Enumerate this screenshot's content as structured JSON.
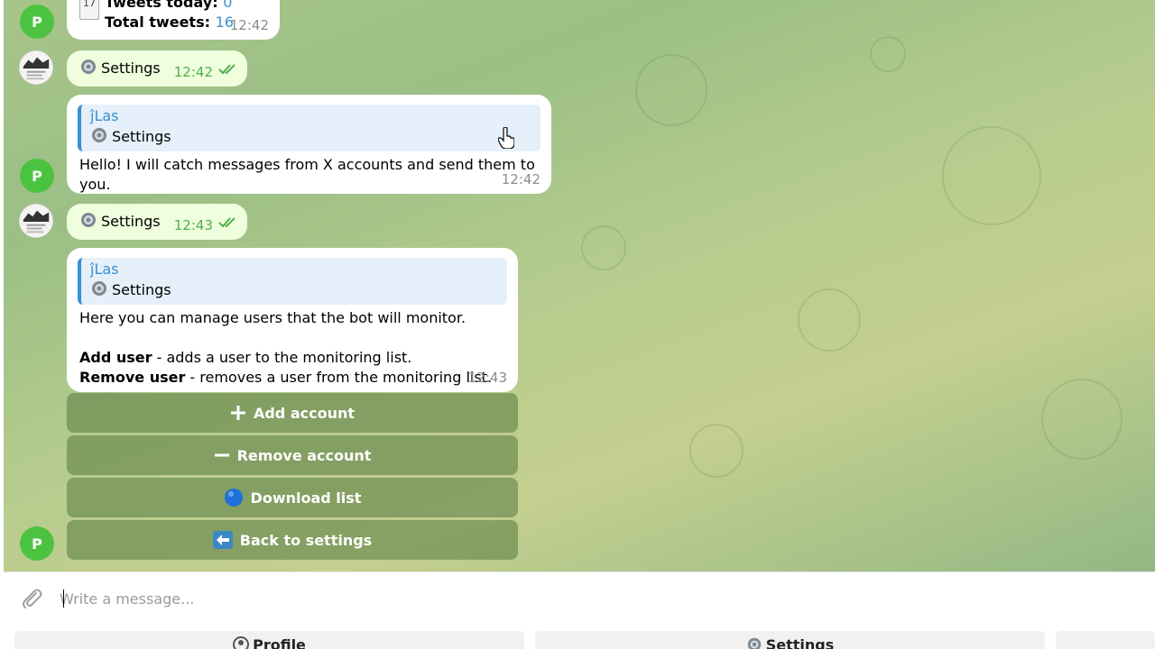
{
  "messages": {
    "m1": {
      "line1_label": "Tweets today: ",
      "line1_value": "0",
      "line2_label": "Total tweets: ",
      "line2_value": "16",
      "time": "12:42",
      "calendar_day": "17"
    },
    "m2": {
      "text": "Settings",
      "time": "12:42"
    },
    "m3": {
      "reply_name": "ĵLas",
      "reply_text": "Settings",
      "text": "Hello! I will catch messages from X accounts and send them to you.",
      "time": "12:42"
    },
    "m4": {
      "text": "Settings",
      "time": "12:43"
    },
    "m5": {
      "reply_name": "ĵLas",
      "reply_text": "Settings",
      "line1": "Here you can manage users that the bot will monitor.",
      "line2_bold": "Add user",
      "line2_rest": " - adds a user to the monitoring list.",
      "line3_bold": "Remove user",
      "line3_rest": " - removes a user from the monitoring list.",
      "time": "12:43"
    }
  },
  "avatar_letter": "P",
  "inline_keyboard": {
    "add": "Add account",
    "remove": "Remove account",
    "download": "Download list",
    "back": "Back to settings"
  },
  "composer": {
    "placeholder": "Write a message..."
  },
  "reply_keyboard": {
    "profile": "Profile",
    "settings": "Settings"
  },
  "colors": {
    "accent": "#3a8fd1",
    "avatar": "#4cc340",
    "check": "#4fae4e"
  }
}
